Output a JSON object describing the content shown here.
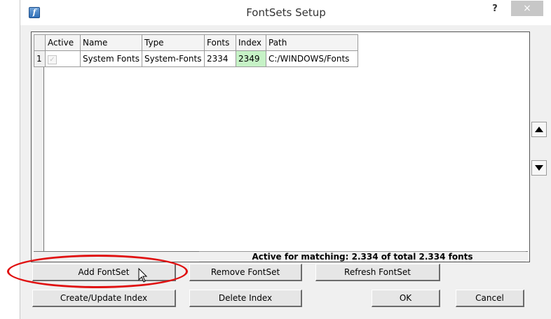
{
  "window": {
    "title": "FontSets Setup",
    "help_label": "?",
    "close_label": "×",
    "app_icon_glyph": "f"
  },
  "table": {
    "columns": [
      "Active",
      "Name",
      "Type",
      "Fonts",
      "Index",
      "Path"
    ],
    "rows": [
      {
        "row_number": "1",
        "active": true,
        "name": "System Fonts",
        "type": "System-Fonts",
        "fonts": "2334",
        "index": "2349",
        "path": "C:/WINDOWS/Fonts"
      }
    ]
  },
  "status": {
    "text": "Active for matching: 2.334 of total 2.334 fonts"
  },
  "buttons": {
    "add_fontset": "Add FontSet",
    "remove_fontset": "Remove FontSet",
    "refresh_fontset": "Refresh FontSet",
    "create_update_index": "Create/Update Index",
    "delete_index": "Delete Index",
    "ok": "OK",
    "cancel": "Cancel"
  },
  "icons": {
    "move_up": "arrow-up-icon",
    "move_down": "arrow-down-icon",
    "checkbox_glyph": "✓"
  },
  "colors": {
    "index_cell_highlight": "#c6f2c6",
    "annotation_circle": "#e01010"
  }
}
